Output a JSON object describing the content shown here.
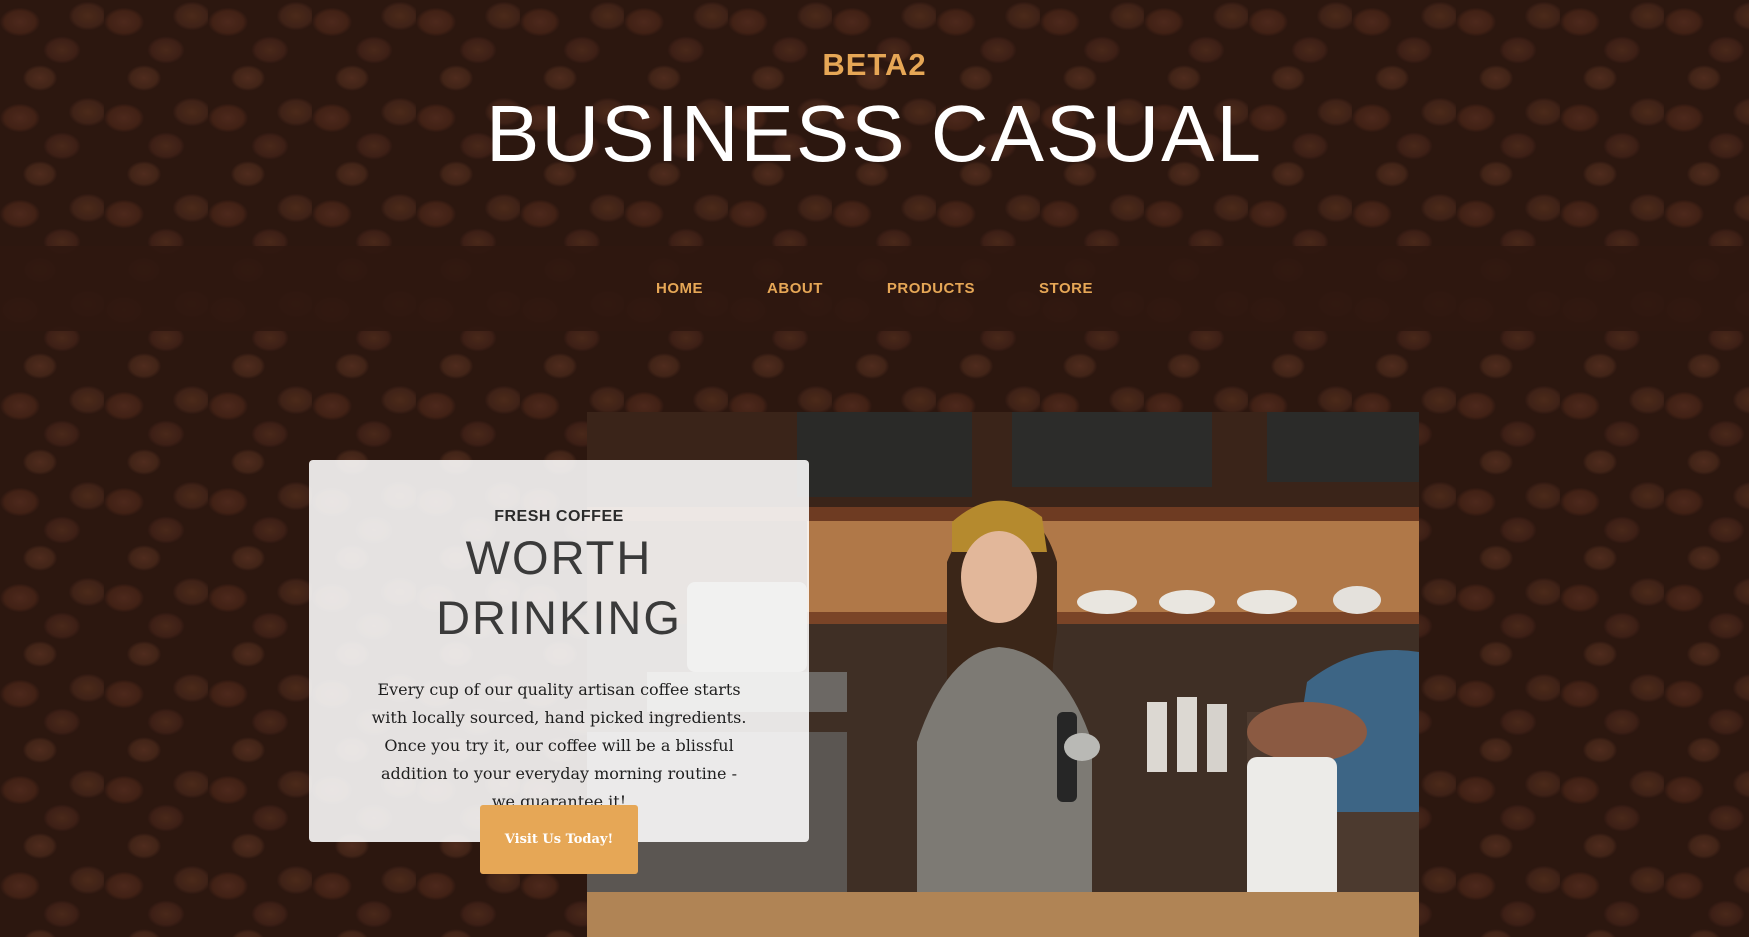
{
  "header": {
    "upper": "BETA2",
    "lower": "BUSINESS CASUAL"
  },
  "nav": {
    "items": [
      {
        "label": "HOME"
      },
      {
        "label": "ABOUT"
      },
      {
        "label": "PRODUCTS"
      },
      {
        "label": "STORE"
      }
    ]
  },
  "intro": {
    "upper": "FRESH COFFEE",
    "lower_line1": "WORTH",
    "lower_line2": "DRINKING",
    "body": "Every cup of our quality artisan coffee starts with locally sourced, hand picked ingredients. Once you try it, our coffee will be a blissful addition to your everyday morning routine - we guarantee it!",
    "button_label": "Visit Us Today!"
  },
  "colors": {
    "accent": "#e6a756",
    "navbar_bg": "#2f170f",
    "card_bg": "#ffffff"
  },
  "images": {
    "hero_photo": "barista-smiling-photo",
    "background": "coffee-beans-texture"
  }
}
